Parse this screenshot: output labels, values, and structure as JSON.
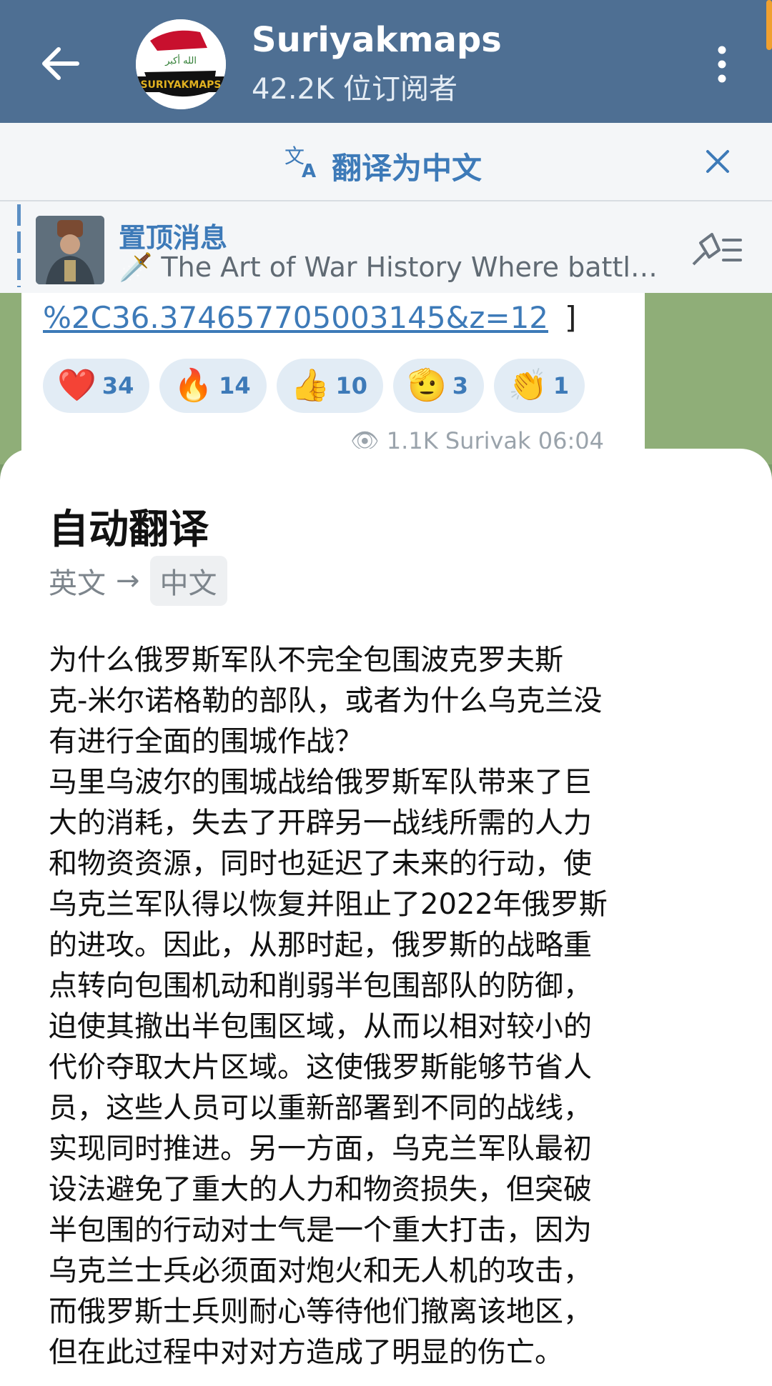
{
  "header": {
    "channel_name": "Suriyakmaps",
    "subscribers": "42.2K 位订阅者",
    "avatar_text": "SURIYAKMAPS"
  },
  "translate_bar": {
    "label": "翻译为中文"
  },
  "pinned": {
    "title": "置顶消息",
    "text": "🗡️ The Art of War History Where battl…"
  },
  "message": {
    "link_text": "%2C36.374657705003145&z=12",
    "bracket": "]",
    "reactions": [
      {
        "emoji": "❤️",
        "count": "34"
      },
      {
        "emoji": "🔥",
        "count": "14"
      },
      {
        "emoji": "👍",
        "count": "10"
      },
      {
        "emoji": "🫡",
        "count": "3"
      },
      {
        "emoji": "👏",
        "count": "1"
      }
    ],
    "meta": "👁 1.1K  Suriyak  06:04"
  },
  "sheet": {
    "title": "自动翻译",
    "source_lang": "英文",
    "arrow": "→",
    "target_lang": "中文",
    "body": "为什么俄罗斯军队不完全包围波克罗夫斯\n克-米尔诺格勒的部队，或者为什么乌克兰没\n有进行全面的围城作战？\n马里乌波尔的围城战给俄罗斯军队带来了巨\n大的消耗，失去了开辟另一战线所需的人力\n和物资资源，同时也延迟了未来的行动，使\n乌克兰军队得以恢复并阻止了2022年俄罗斯\n的进攻。因此，从那时起，俄罗斯的战略重\n点转向包围机动和削弱半包围部队的防御，\n迫使其撤出半包围区域，从而以相对较小的\n代价夺取大片区域。这使俄罗斯能够节省人\n员，这些人员可以重新部署到不同的战线，\n实现同时推进。另一方面，乌克兰军队最初\n设法避免了重大的人力和物资损失，但突破\n半包围的行动对士气是一个重大打击，因为\n乌克兰士兵必须面对炮火和无人机的攻击，\n而俄罗斯士兵则耐心等待他们撤离该地区，\n但在此过程中对对方造成了明显的伤亡。"
  },
  "colors": {
    "header_bg": "#4e6f93",
    "accent_blue": "#3d7ab8",
    "chat_bg": "#8fae78"
  }
}
